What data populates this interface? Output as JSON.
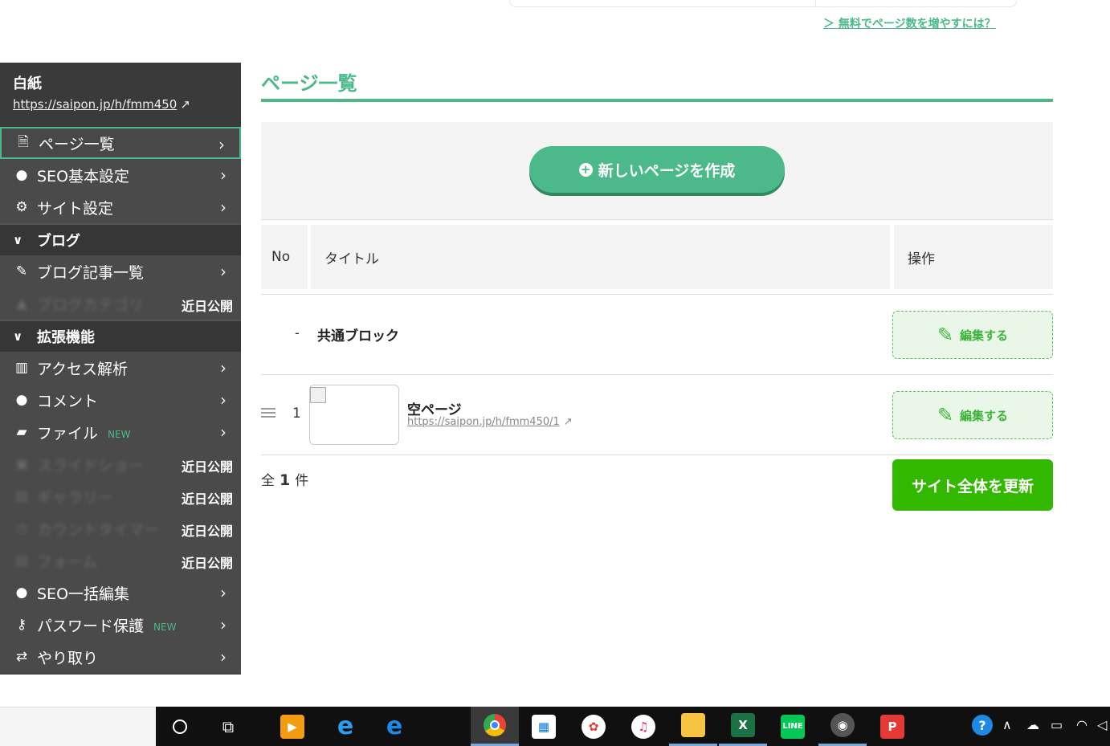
{
  "top": {
    "free_link": "＞ 無料でページ数を増やすには？"
  },
  "sidebar": {
    "site_title": "白紙",
    "site_url": "https://saipon.jp/h/fmm450",
    "items_main": [
      {
        "label": "ページ一覧",
        "icon": "page-icon"
      },
      {
        "label": "SEO基本設定",
        "icon": "globe-icon"
      },
      {
        "label": "サイト設定",
        "icon": "gear-icon"
      }
    ],
    "section_blog": "ブログ",
    "items_blog": [
      {
        "label": "ブログ記事一覧",
        "icon": "edit-icon"
      },
      {
        "label": "ブログカテゴリ",
        "icon": "sitemap-icon",
        "soon": "近日公開"
      }
    ],
    "section_ext": "拡張機能",
    "items_ext": [
      {
        "label": "アクセス解析",
        "icon": "bar-chart-icon"
      },
      {
        "label": "コメント",
        "icon": "comment-icon"
      },
      {
        "label": "ファイル",
        "icon": "folder-open-icon",
        "badge": "NEW"
      },
      {
        "label": "スライドショー",
        "icon": "slideshow-icon",
        "soon": "近日公開"
      },
      {
        "label": "ギャラリー",
        "icon": "image-icon",
        "soon": "近日公開"
      },
      {
        "label": "カウントタイマー",
        "icon": "clock-icon",
        "soon": "近日公開"
      },
      {
        "label": "フォーム",
        "icon": "form-icon",
        "soon": "近日公開"
      },
      {
        "label": "SEO一括編集",
        "icon": "globe-icon"
      },
      {
        "label": "パスワード保護",
        "icon": "key-icon",
        "badge": "NEW"
      },
      {
        "label": "やり取り",
        "icon": "exchange-icon"
      }
    ]
  },
  "main": {
    "title": "ページ一覧",
    "create_button": "新しいページを作成",
    "table_headers": {
      "no": "No",
      "title": "タイトル",
      "ops": "操作"
    },
    "common_block": {
      "dash": "-",
      "label": "共通ブロック",
      "edit": "編集する"
    },
    "rows": [
      {
        "no": "1",
        "title": "空ページ",
        "url": "https://saipon.jp/h/fmm450/1",
        "edit": "編集する"
      }
    ],
    "total_prefix": "全",
    "total_count": "1",
    "total_suffix": "件",
    "update_button": "サイト全体を更新"
  },
  "colors": {
    "accent": "#4cb98a",
    "update": "#33b800",
    "sidebar": "#444444"
  },
  "taskbar": {
    "apps": [
      "cortana-icon",
      "task-view-icon",
      "media-player-icon",
      "internet-explorer-icon",
      "edge-icon",
      "chrome-icon",
      "store-icon",
      "photo-app-icon",
      "itunes-icon",
      "file-explorer-icon",
      "excel-icon",
      "line-icon",
      "music-icon",
      "pocket-icon"
    ],
    "tray": [
      "help-icon",
      "chevron-up-icon",
      "onedrive-icon",
      "battery-icon",
      "wifi-icon",
      "speaker-icon"
    ]
  }
}
